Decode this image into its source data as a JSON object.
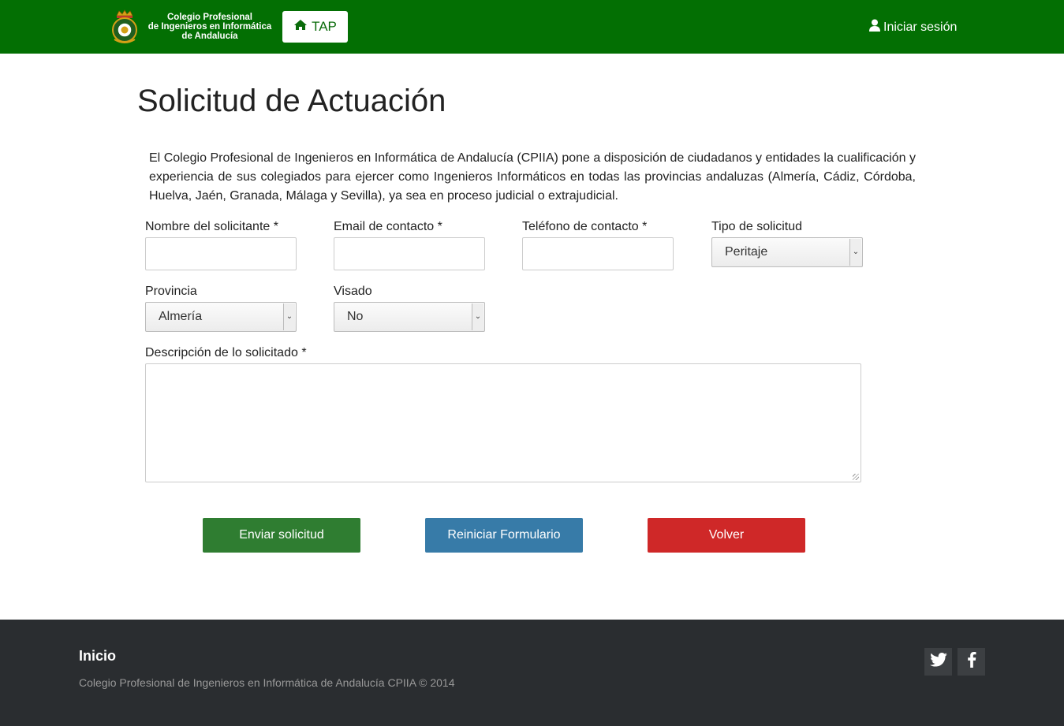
{
  "header": {
    "brand_lines": [
      "Colegio Profesional",
      "de Ingenieros en Informática",
      "de Andalucía"
    ],
    "tap_label": "TAP",
    "login_label": "Iniciar sesión"
  },
  "main": {
    "title": "Solicitud de Actuación",
    "intro": "El Colegio Profesional de Ingenieros en Informática de Andalucía (CPIIA) pone a disposición de ciudadanos y entidades la cualificación y experiencia de sus colegiados para ejercer como Ingenieros Informáticos en todas las provincias andaluzas (Almería, Cádiz, Córdoba, Huelva, Jaén, Granada, Málaga y Sevilla), ya sea en proceso judicial o extrajudicial."
  },
  "form": {
    "nombre": {
      "label": "Nombre del solicitante *",
      "value": ""
    },
    "email": {
      "label": "Email de contacto *",
      "value": ""
    },
    "telefono": {
      "label": "Teléfono de contacto *",
      "value": ""
    },
    "tipo": {
      "label": "Tipo de solicitud",
      "selected": "Peritaje"
    },
    "provincia": {
      "label": "Provincia",
      "selected": "Almería"
    },
    "visado": {
      "label": "Visado",
      "selected": "No"
    },
    "descripcion": {
      "label": "Descripción de lo solicitado *",
      "value": ""
    }
  },
  "buttons": {
    "send": "Enviar solicitud",
    "reset": "Reiniciar Formulario",
    "back": "Volver"
  },
  "footer": {
    "title": "Inicio",
    "copyright": "Colegio Profesional de Ingenieros en Informática de Andalucía CPIIA © 2014"
  },
  "colors": {
    "navbar": "#036f03",
    "send": "#2f7d31",
    "reset": "#377ba8",
    "back": "#cf2828",
    "footer": "#2a2d30"
  },
  "icons": {
    "tap": "home-icon",
    "login": "user-icon",
    "twitter": "twitter-icon",
    "facebook": "facebook-icon"
  }
}
